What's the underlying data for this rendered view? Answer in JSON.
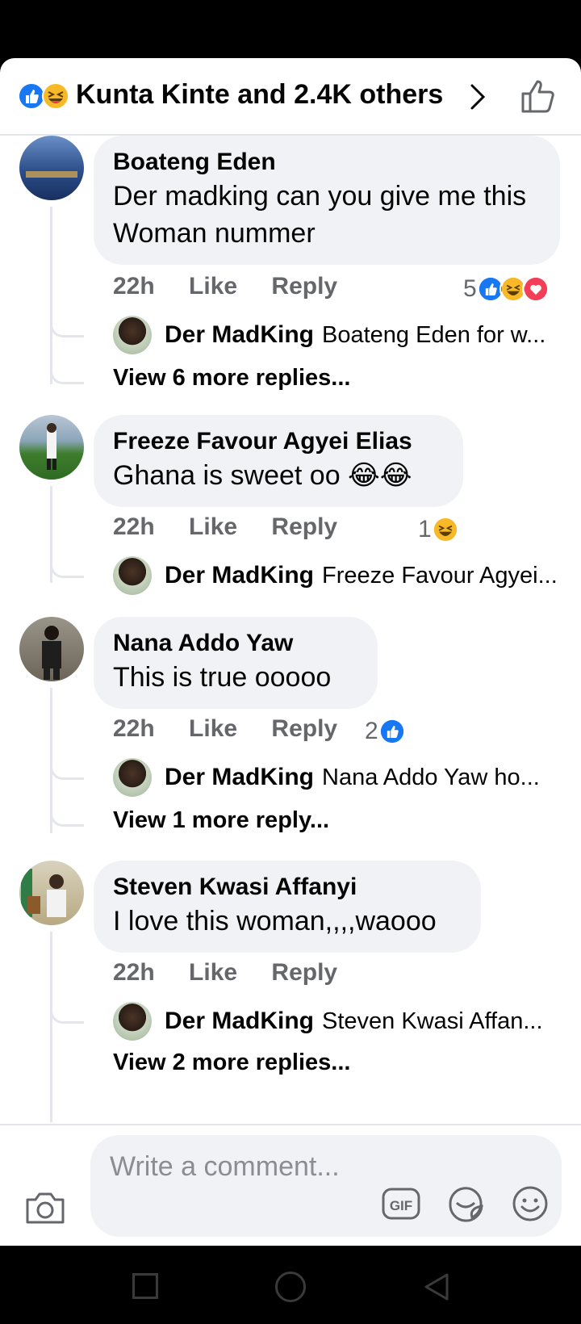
{
  "header": {
    "title": "Kunta Kinte and 2.4K others"
  },
  "comments": [
    {
      "author": "Boateng Eden",
      "text": "Der madking can you give me this Woman nummer",
      "time": "22h",
      "like": "Like",
      "reply": "Reply",
      "reaction_count": "5",
      "reply_author": "Der MadKing",
      "reply_snippet": "Boateng Eden for w...",
      "view_more": "View 6 more replies..."
    },
    {
      "author": "Freeze Favour Agyei Elias",
      "text": "Ghana is sweet oo 😂😂",
      "time": "22h",
      "like": "Like",
      "reply": "Reply",
      "reaction_count": "1",
      "reply_author": "Der MadKing",
      "reply_snippet": "Freeze Favour Agyei..."
    },
    {
      "author": "Nana Addo Yaw",
      "text": "This is true ooooo",
      "time": "22h",
      "like": "Like",
      "reply": "Reply",
      "reaction_count": "2",
      "reply_author": "Der MadKing",
      "reply_snippet": "Nana Addo Yaw ho...",
      "view_more": "View 1 more reply..."
    },
    {
      "author": "Steven Kwasi Affanyi",
      "text": "I love this woman,,,,waooo",
      "time": "22h",
      "like": "Like",
      "reply": "Reply",
      "reply_author": "Der MadKing",
      "reply_snippet": "Steven Kwasi Affan...",
      "view_more": "View 2 more replies..."
    }
  ],
  "composer": {
    "placeholder": "Write a comment...",
    "gif_label": "GIF"
  },
  "colors": {
    "like_blue": "#1877f2",
    "haha_yellow": "#f7b928",
    "love_red": "#f33e58",
    "bubble_gray": "#f0f2f5",
    "meta_gray": "#65676b"
  }
}
